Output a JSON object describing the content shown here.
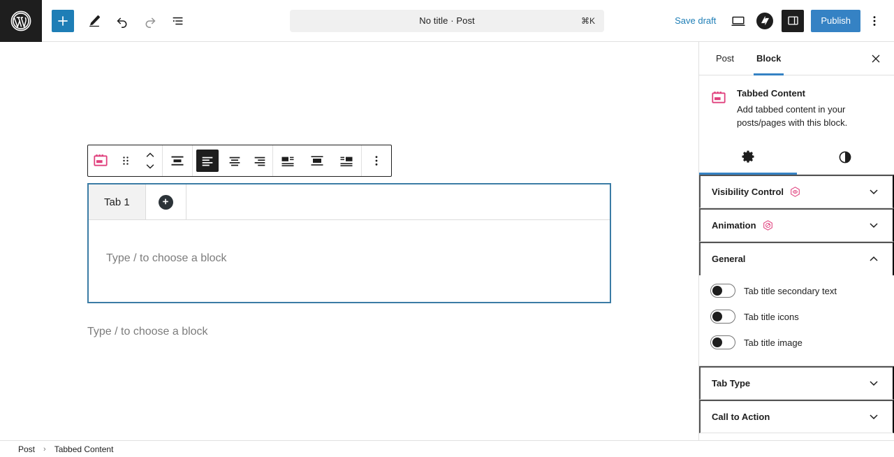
{
  "header": {
    "logo_icon": "wordpress-logo",
    "add_block_label": "+",
    "add_block_icon": "plus-icon",
    "tools_icon": "pencil-edit-icon",
    "undo_icon": "undo-icon",
    "redo_icon": "redo-icon",
    "list_view_icon": "document-overview-icon",
    "command_bar": {
      "title": "No title · Post",
      "shortcut": "⌘K"
    },
    "save_draft_label": "Save draft",
    "preview_icon": "desktop-preview-icon",
    "jetpack_icon": "jetpack-logo-icon",
    "settings_sidebar_icon": "sidebar-toggle-icon",
    "publish_label": "Publish",
    "options_icon": "kebab-menu-icon"
  },
  "block_toolbar": {
    "block_type_icon": "tabbed-content-block-icon",
    "drag_icon": "drag-handle-icon",
    "move_up_icon": "chevron-up-icon",
    "move_down_icon": "chevron-down-icon",
    "align_icon": "align-block-icon",
    "text_align_left_icon": "align-text-left-icon",
    "text_align_center_icon": "align-text-center-icon",
    "text_align_right_icon": "align-text-right-icon",
    "position_left_icon": "pull-left-icon",
    "position_center_icon": "position-center-icon",
    "position_right_icon": "pull-right-icon",
    "more_icon": "kebab-menu-icon"
  },
  "canvas": {
    "tabbed_block": {
      "tabs": [
        {
          "label": "Tab 1"
        }
      ],
      "add_tab_icon": "plus-circle-icon",
      "add_tab_label": "+",
      "content_placeholder": "Type / to choose a block"
    },
    "placeholder": "Type / to choose a block",
    "selection_color": "#3b7ca5"
  },
  "sidebar": {
    "tabs": [
      {
        "label": "Post",
        "active": false
      },
      {
        "label": "Block",
        "active": true
      }
    ],
    "close_icon": "close-icon",
    "block_card": {
      "icon": "tabbed-content-block-icon",
      "title": "Tabbed Content",
      "description": "Add tabbed content in your posts/pages with this block."
    },
    "icon_tabs": [
      {
        "icon": "gear-settings-icon",
        "active": true
      },
      {
        "icon": "styles-contrast-icon",
        "active": false
      }
    ],
    "panels": [
      {
        "label": "Visibility Control",
        "badge": "premium-eye-badge",
        "expanded": false,
        "chevron": "chevron-down-icon"
      },
      {
        "label": "Animation",
        "badge": "premium-animation-badge",
        "expanded": false,
        "chevron": "chevron-down-icon"
      },
      {
        "label": "General",
        "badge": null,
        "expanded": true,
        "chevron": "chevron-up-icon"
      },
      {
        "label": "Tab Type",
        "badge": null,
        "expanded": false,
        "chevron": "chevron-down-icon"
      },
      {
        "label": "Call to Action",
        "badge": null,
        "expanded": false,
        "chevron": "chevron-down-icon"
      }
    ],
    "general_toggles": [
      {
        "label": "Tab title secondary text",
        "on": false
      },
      {
        "label": "Tab title icons",
        "on": false
      },
      {
        "label": "Tab title image",
        "on": false
      }
    ],
    "accent_color": "#3582c4",
    "badge_color": "#e0407d"
  },
  "footer": {
    "breadcrumb": [
      {
        "label": "Post"
      },
      {
        "label": "Tabbed Content"
      }
    ],
    "separator": "›"
  }
}
